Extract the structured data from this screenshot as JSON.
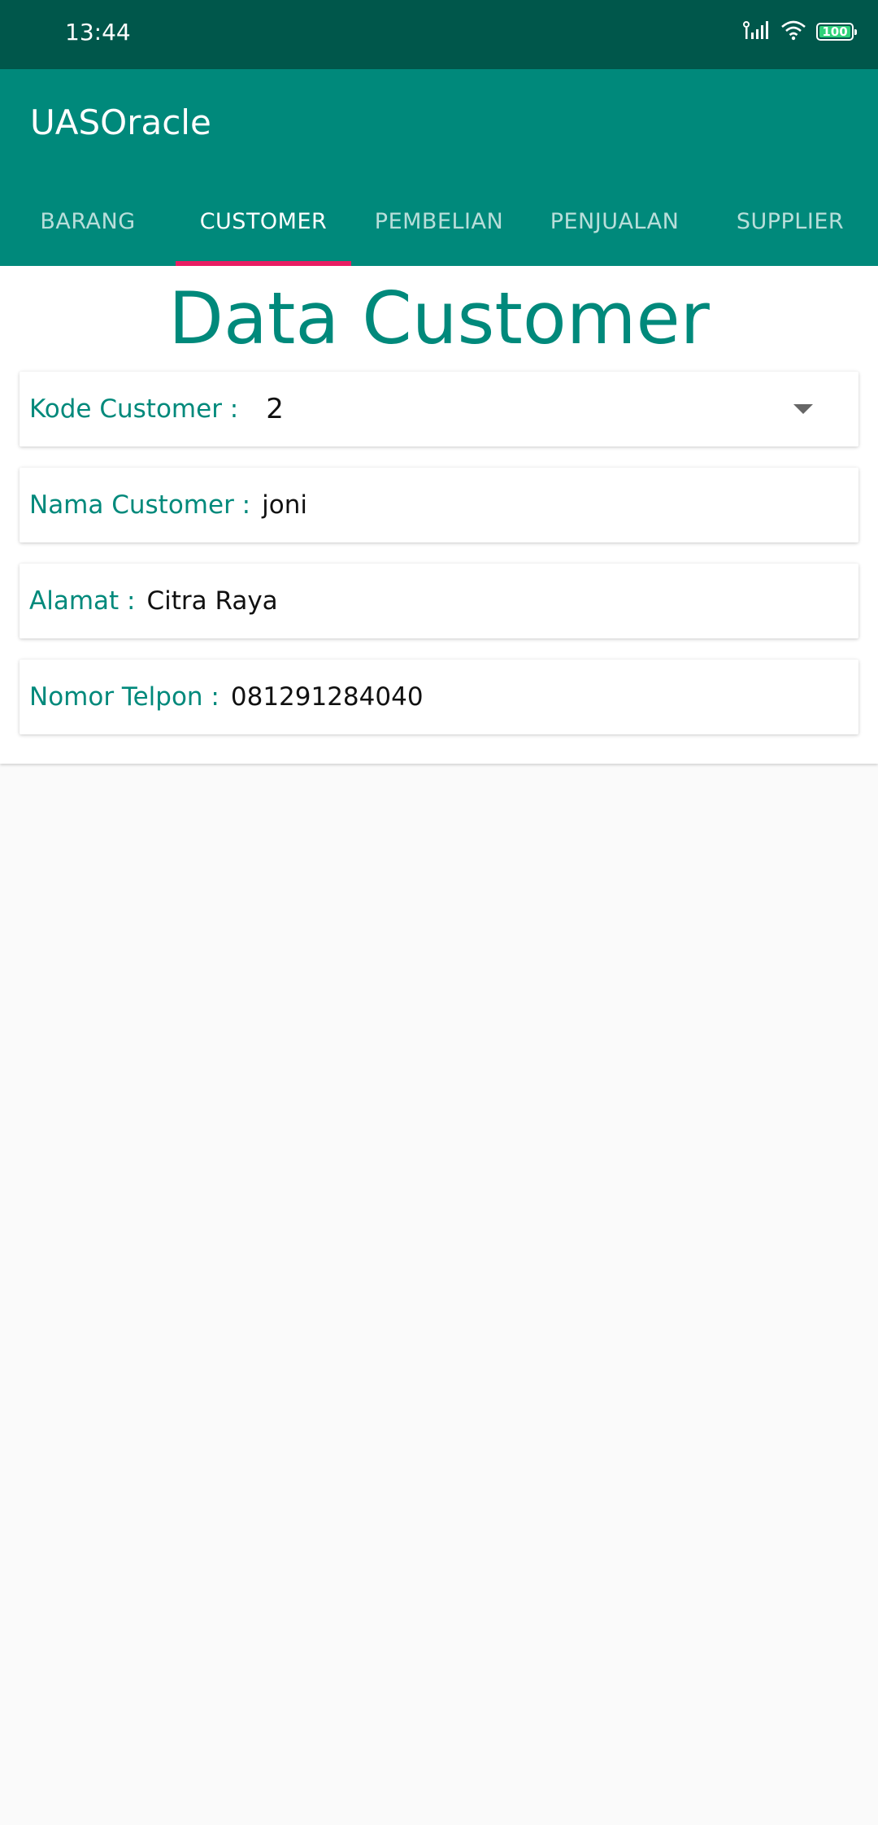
{
  "status_bar": {
    "time": "13:44",
    "battery": "100",
    "icons": [
      "signal-icon",
      "wifi-icon",
      "battery-icon"
    ]
  },
  "app": {
    "title": "UASOracle",
    "colors": {
      "primary": "#00897b",
      "primary_dark": "#00574b",
      "accent": "#e91e63"
    }
  },
  "tabs": [
    {
      "label": "BARANG",
      "active": false
    },
    {
      "label": "CUSTOMER",
      "active": true
    },
    {
      "label": "PEMBELIAN",
      "active": false
    },
    {
      "label": "PENJUALAN",
      "active": false
    },
    {
      "label": "SUPPLIER",
      "active": false
    }
  ],
  "page": {
    "title": "Data Customer"
  },
  "form": {
    "kode_customer": {
      "label": "Kode Customer :",
      "value": "2"
    },
    "nama_customer": {
      "label": "Nama Customer :",
      "value": "joni"
    },
    "alamat": {
      "label": "Alamat :",
      "value": "Citra Raya"
    },
    "nomor_telpon": {
      "label": "Nomor Telpon :",
      "value": "081291284040"
    }
  }
}
